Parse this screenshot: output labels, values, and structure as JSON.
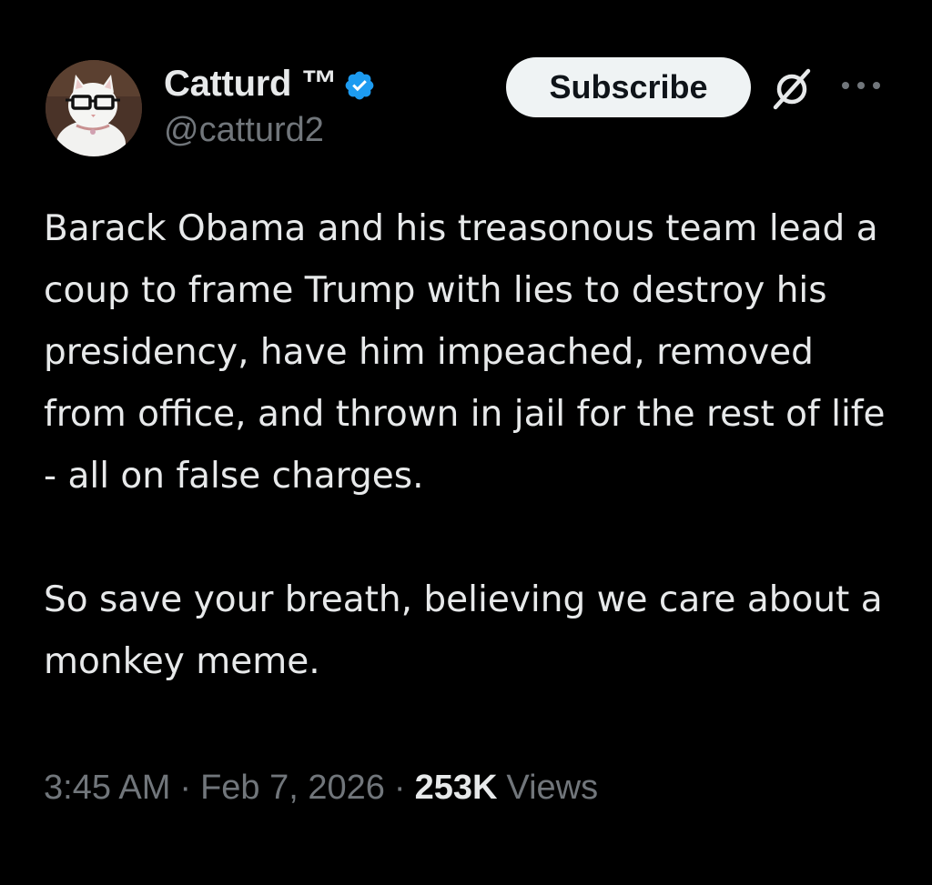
{
  "author": {
    "display_name": "Catturd ™",
    "handle": "@catturd2",
    "verified": true,
    "verified_color": "#1d9bf0",
    "avatar_icon": "cat-with-glasses-avatar"
  },
  "actions": {
    "subscribe_label": "Subscribe",
    "grok_icon": "grok-icon",
    "more_icon": "more-dots-icon"
  },
  "tweet": {
    "paragraphs": [
      "Barack Obama and his treasonous team lead a coup to frame Trump with lies to destroy his presidency, have him impeached, removed from office, and thrown in jail for the rest of life - all on false charges.",
      "So save your breath, believing we care about a monkey meme."
    ]
  },
  "meta": {
    "time": "3:45 AM",
    "date": "Feb 7, 2026",
    "views_count": "253K",
    "views_label": "Views",
    "separator": "·"
  },
  "colors": {
    "background": "#000000",
    "text_primary": "#e7e9ea",
    "text_secondary": "#71767b",
    "button_bg": "#eff3f4",
    "button_text": "#0f1419"
  }
}
